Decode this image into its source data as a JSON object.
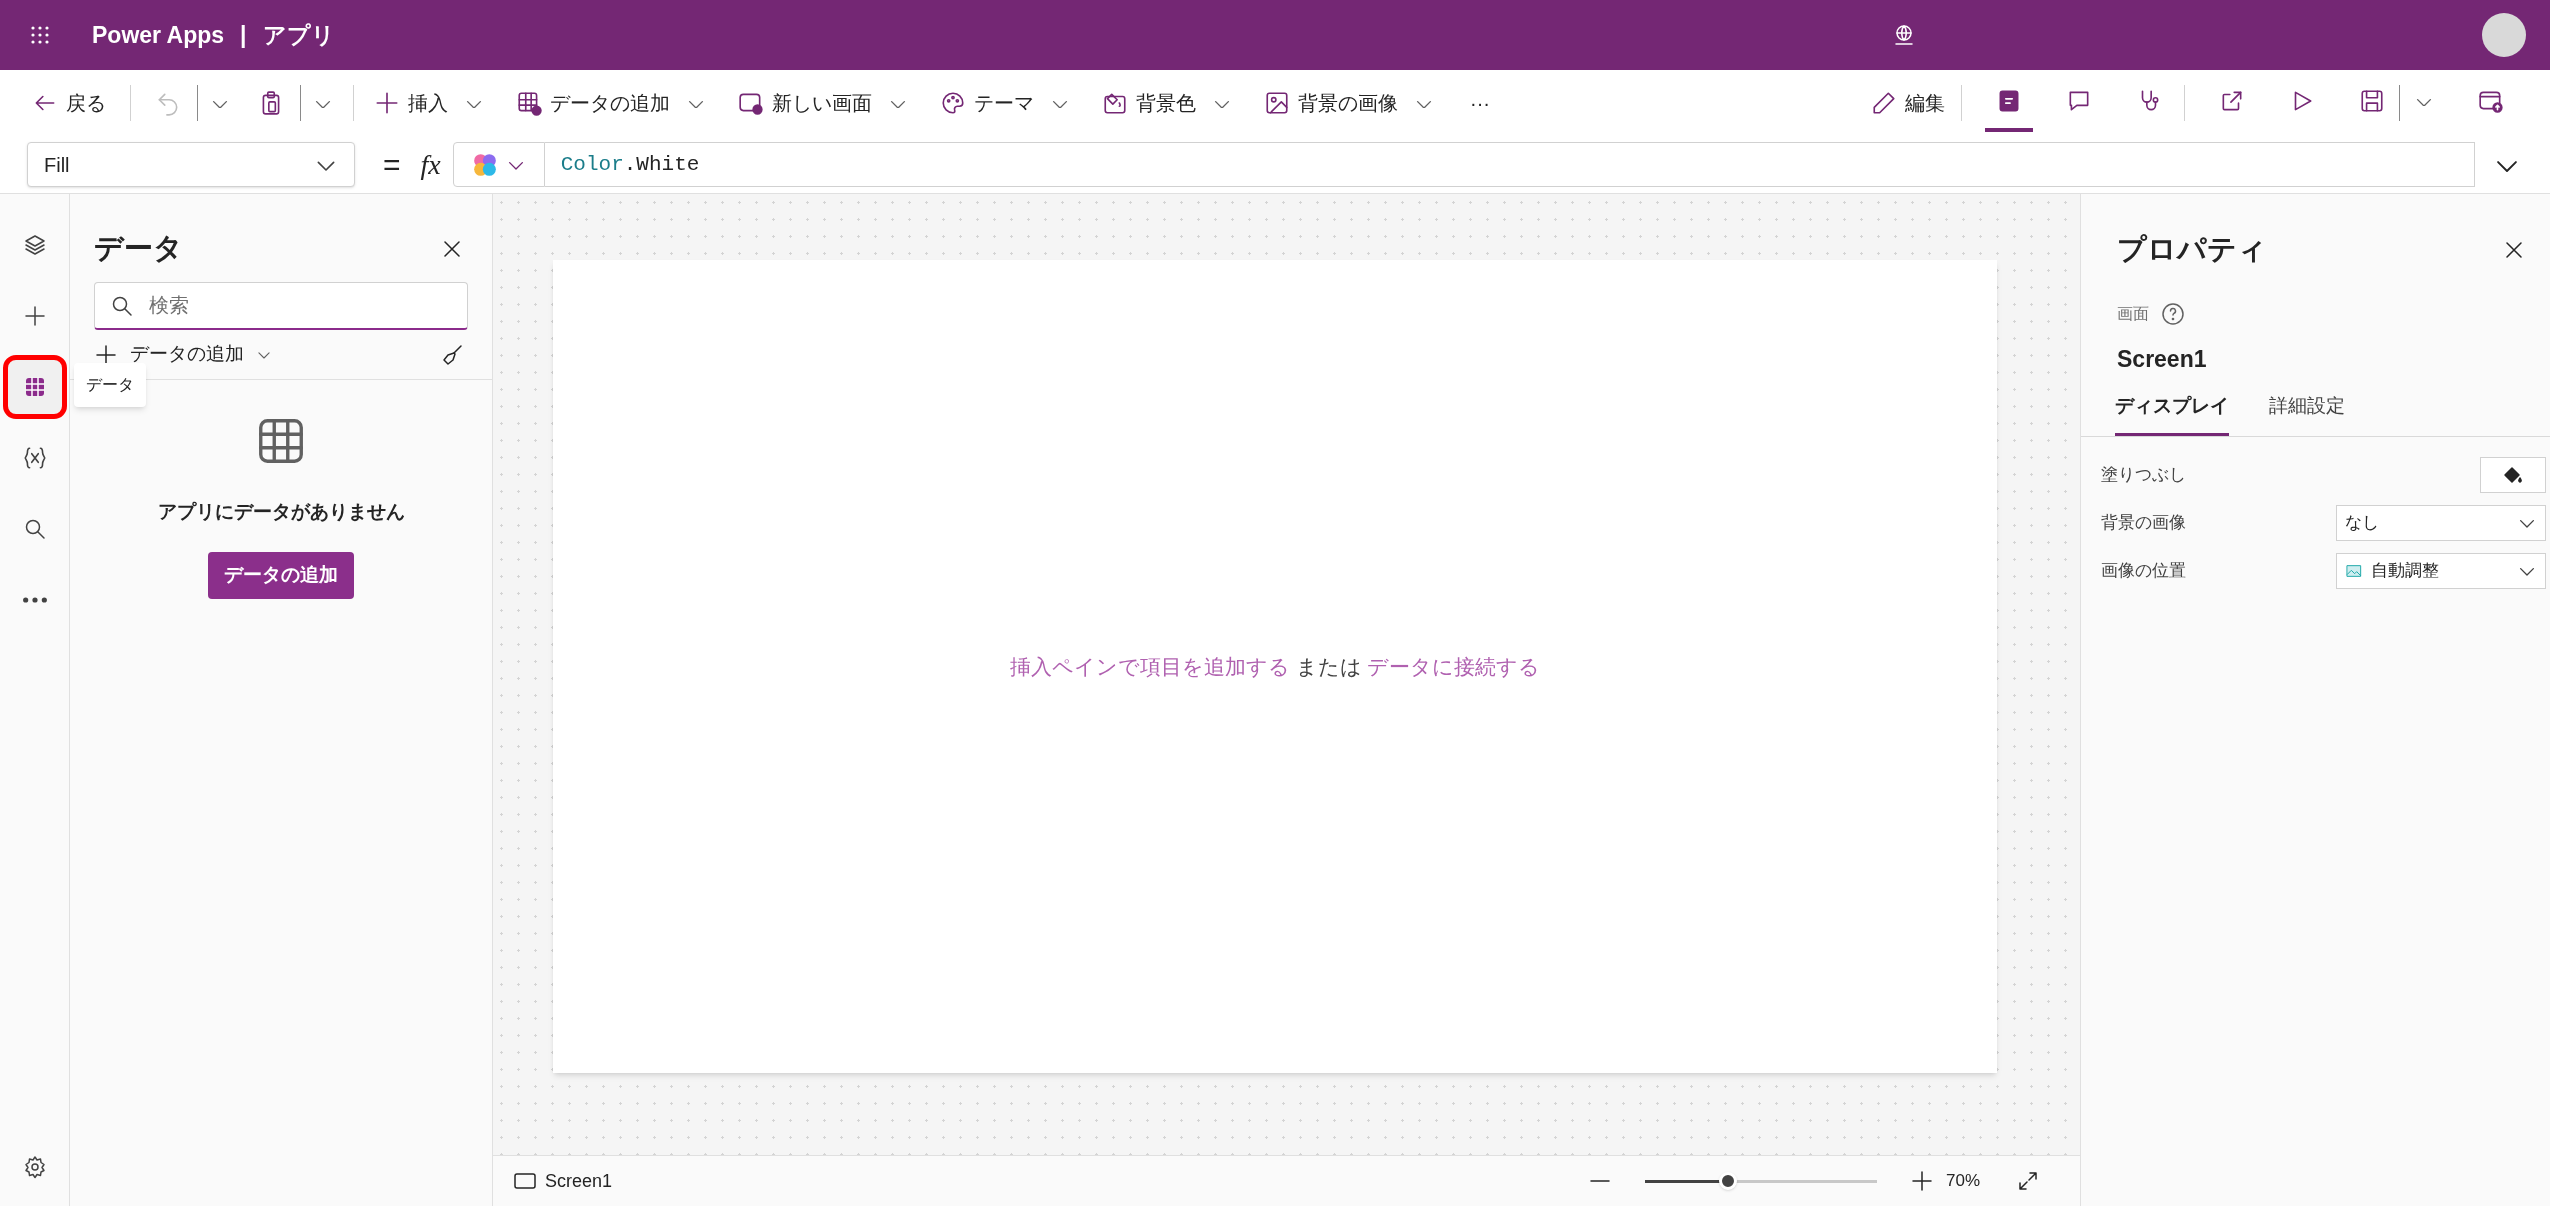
{
  "app_bar": {
    "product": "Power Apps",
    "separator": "|",
    "app_name": "アプリ"
  },
  "toolbar": {
    "left": [
      {
        "kind": "button",
        "label": "戻る",
        "menu": false
      },
      {
        "kind": "icon",
        "disabled": true
      },
      {
        "kind": "caret",
        "disabled": false
      },
      {
        "kind": "icon",
        "disabled": false
      },
      {
        "kind": "caret",
        "disabled": false
      },
      {
        "kind": "button",
        "label": "挿入",
        "menu": true
      },
      {
        "kind": "button",
        "label": "データの追加",
        "menu": true
      },
      {
        "kind": "button",
        "label": "新しい画面",
        "menu": true
      },
      {
        "kind": "button",
        "label": "テーマ",
        "menu": true
      },
      {
        "kind": "button",
        "label": "背景色",
        "menu": true
      },
      {
        "kind": "button",
        "label": "背景の画像",
        "menu": true
      },
      {
        "kind": "text",
        "label": "···"
      }
    ],
    "right": [
      {
        "kind": "button",
        "label": "編集"
      },
      {
        "kind": "icon",
        "selected": true
      },
      {
        "kind": "icon",
        "selected": false
      },
      {
        "kind": "icon",
        "selected": false
      },
      {
        "kind": "icon",
        "selected": false
      },
      {
        "kind": "icon",
        "selected": false
      },
      {
        "kind": "icon",
        "selected": false
      },
      {
        "kind": "caret",
        "selected": false
      },
      {
        "kind": "icon",
        "selected": false
      }
    ]
  },
  "formula_bar": {
    "property": "Fill",
    "equals": "=",
    "fx": "fx",
    "formula": [
      {
        "text": "Color",
        "kind": "keyword"
      },
      {
        "text": ".White",
        "kind": "plain"
      }
    ]
  },
  "left_rail": {
    "items": [
      {
        "selected": false,
        "highlighted": false
      },
      {
        "selected": false,
        "highlighted": false
      },
      {
        "selected": true,
        "highlighted": true,
        "tooltip": "データ"
      },
      {
        "selected": false,
        "highlighted": false
      },
      {
        "selected": false,
        "highlighted": false
      },
      {
        "selected": false,
        "highlighted": false
      }
    ],
    "bottom": [
      {
        "selected": false,
        "highlighted": false
      }
    ]
  },
  "data_panel": {
    "title": "データ",
    "search": {
      "placeholder": "検索"
    },
    "add_data": "データの追加",
    "empty_message": "アプリにデータがありません",
    "add_button": "データの追加"
  },
  "canvas": {
    "message": [
      {
        "text": "挿入ペインで項目を追加する",
        "link": true
      },
      {
        "text": "または",
        "link": false
      },
      {
        "text": "データに接続する",
        "link": true
      }
    ]
  },
  "status_bar": {
    "screen": "Screen1",
    "zoom": {
      "level": 0.36
    },
    "zoom_reading": "70%"
  },
  "properties_panel": {
    "title": "プロパティ",
    "type": "画面",
    "name": "Screen1",
    "tabs": [
      {
        "label": "ディスプレイ",
        "selected": true
      },
      {
        "label": "詳細設定",
        "selected": false
      }
    ],
    "rows": [
      {
        "kind": "color",
        "label": "塗りつぶし"
      },
      {
        "kind": "dropdown",
        "label": "背景の画像",
        "value": "なし",
        "with_icon": false
      },
      {
        "kind": "dropdown",
        "label": "画像の位置",
        "value": "自動調整",
        "with_icon": true
      }
    ]
  }
}
